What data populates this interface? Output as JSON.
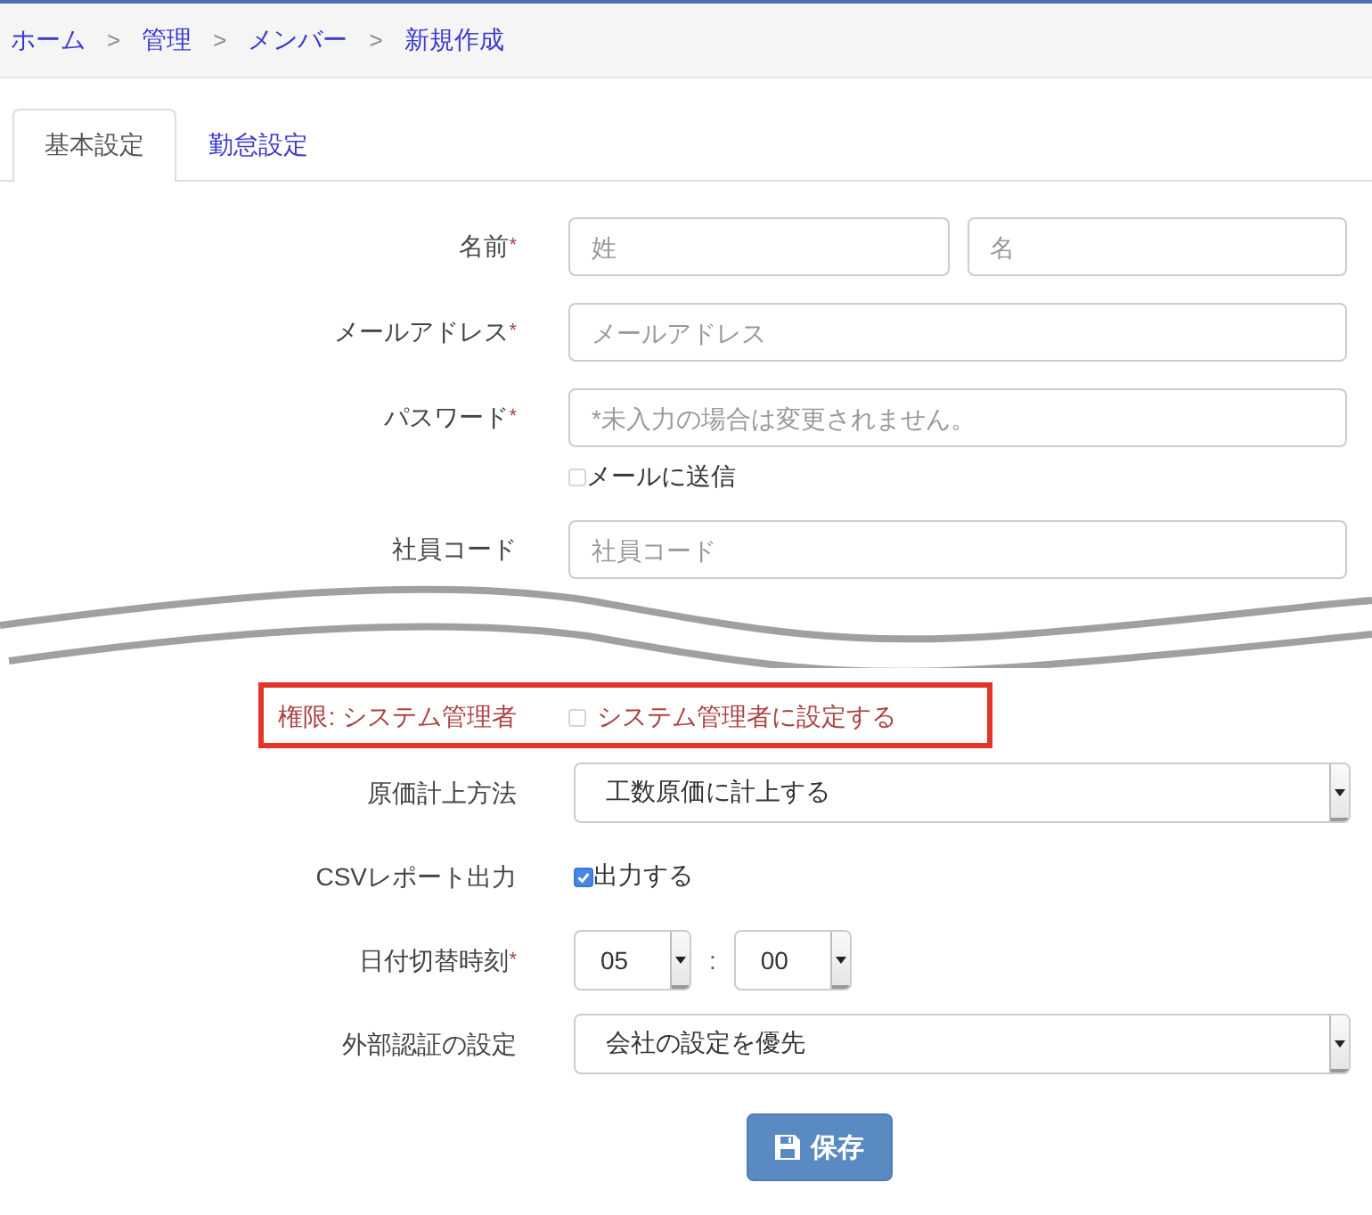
{
  "breadcrumb": [
    {
      "kind": "link",
      "label": "ホーム"
    },
    {
      "kind": "separator",
      "label": ">"
    },
    {
      "kind": "link",
      "label": "管理"
    },
    {
      "kind": "separator",
      "label": ">"
    },
    {
      "kind": "link",
      "label": "メンバー"
    },
    {
      "kind": "separator",
      "label": ">"
    },
    {
      "kind": "current",
      "label": "新規作成"
    }
  ],
  "tabs": [
    {
      "label": "基本設定",
      "selected": true
    },
    {
      "label": "勤怠設定",
      "selected": false
    }
  ],
  "sections": [
    {
      "rows": [
        {
          "kind": "inputs",
          "label": "名前",
          "required_mark": "*",
          "fields": [
            {
              "placeholder": "姓"
            },
            {
              "placeholder": "名"
            }
          ]
        },
        {
          "kind": "inputs",
          "label": "メールアドレス",
          "required_mark": "*",
          "fields": [
            {
              "placeholder": "メールアドレス"
            }
          ]
        },
        {
          "kind": "inputs",
          "label": "パスワード",
          "required_mark": "*",
          "fields": [
            {
              "placeholder": "*未入力の場合は変更されません。"
            }
          ],
          "checkbox": {
            "label": "メールに送信",
            "checked": false
          }
        },
        {
          "kind": "inputs",
          "label": "社員コード",
          "fields": [
            {
              "placeholder": "社員コード"
            }
          ]
        }
      ]
    },
    {
      "rows": [
        {
          "kind": "checkbox",
          "label": "権限: システム管理者",
          "highlighted": true,
          "checkbox": {
            "label": "システム管理者に設定する",
            "checked": false
          }
        },
        {
          "kind": "select",
          "label": "原価計上方法",
          "value": "工数原価に計上する"
        },
        {
          "kind": "checkbox",
          "label": "CSVレポート出力",
          "highlighted": false,
          "checkbox": {
            "label": "出力する",
            "checked": true
          }
        },
        {
          "kind": "time",
          "label": "日付切替時刻",
          "required_mark": "*",
          "hour": "05",
          "separator": ":",
          "minute": "00"
        },
        {
          "kind": "select",
          "label": "外部認証の設定",
          "value": "会社の設定を優先"
        }
      ]
    }
  ],
  "save_button": {
    "label": "保存"
  }
}
